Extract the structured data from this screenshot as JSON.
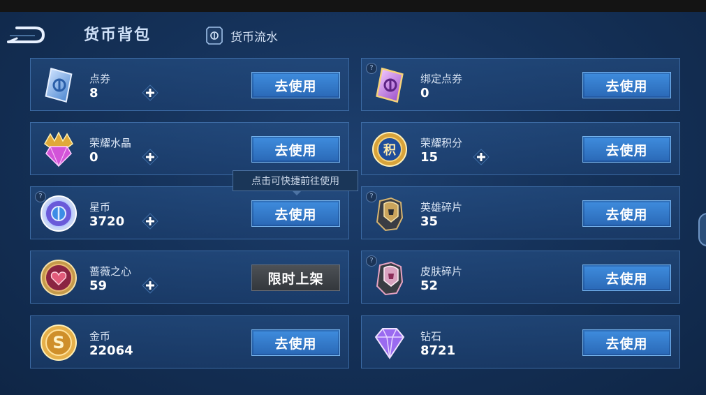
{
  "header": {
    "title": "货币背包",
    "flow_label": "货币流水"
  },
  "tooltip": "点击可快捷前往使用",
  "currencies": [
    {
      "name": "点券",
      "amount": "8",
      "button": "去使用",
      "icon": "ticket-icon"
    },
    {
      "name": "绑定点券",
      "amount": "0",
      "button": "去使用",
      "icon": "bound-ticket-icon"
    },
    {
      "name": "荣耀水晶",
      "amount": "0",
      "button": "去使用",
      "icon": "crystal-icon"
    },
    {
      "name": "荣耀积分",
      "amount": "15",
      "button": "去使用",
      "icon": "points-icon",
      "icon_text": "积"
    },
    {
      "name": "星币",
      "amount": "3720",
      "button": "去使用",
      "icon": "star-coin-icon"
    },
    {
      "name": "英雄碎片",
      "amount": "35",
      "button": "去使用",
      "icon": "hero-fragment-icon"
    },
    {
      "name": "蔷薇之心",
      "amount": "59",
      "button": "限时上架",
      "icon": "rose-heart-icon"
    },
    {
      "name": "皮肤碎片",
      "amount": "52",
      "button": "去使用",
      "icon": "skin-fragment-icon"
    },
    {
      "name": "金币",
      "amount": "22064",
      "button": "去使用",
      "icon": "gold-coin-icon",
      "icon_text": "S"
    },
    {
      "name": "钻石",
      "amount": "8721",
      "button": "去使用",
      "icon": "diamond-icon"
    }
  ],
  "help_mark": "?",
  "colors": {
    "button_blue": "#3f8dde",
    "button_gray": "#4d5156",
    "card_border": "#3c6aa3",
    "background": "#15325a"
  }
}
